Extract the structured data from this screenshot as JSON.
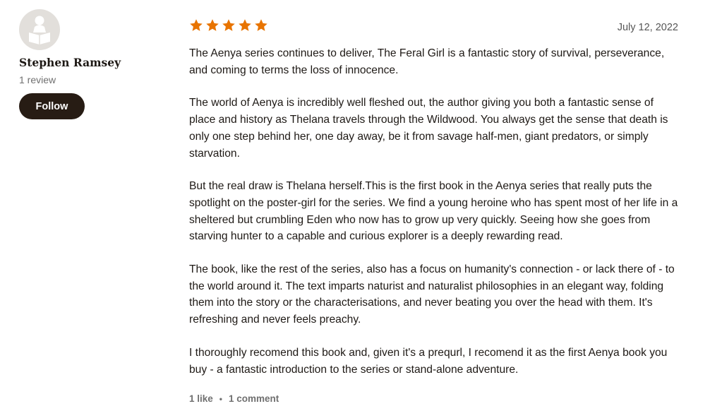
{
  "reviewer": {
    "name": "Stephen Ramsey",
    "review_count": "1 review",
    "follow_label": "Follow",
    "avatar_icon": "reader-silhouette-icon"
  },
  "review": {
    "rating": 5,
    "max_rating": 5,
    "star_color": "#e87400",
    "date": "July 12, 2022",
    "paragraphs": [
      "The Aenya series continues to deliver, The Feral Girl is a fantastic story of survival, perseverance, and coming to terms the loss of innocence.",
      "The world of Aenya is incredibly well fleshed out, the author giving you both a fantastic sense of place and history as Thelana travels through the Wildwood. You always get the sense that death is only one step behind her, one day away, be it from savage half-men, giant predators, or simply starvation.",
      "But the real draw is Thelana herself.This is the first book in the Aenya series that really puts the spotlight on the poster-girl for the series. We find a young heroine who has spent most of her life in a sheltered but crumbling Eden who now has to grow up very quickly. Seeing how she goes from starving hunter to a capable and curious explorer is a deeply rewarding read.",
      "The book, like the rest of the series, also has a focus on humanity's connection - or lack there of - to the world around it. The text imparts naturist and naturalist philosophies in an elegant way, folding them into the story or the characterisations, and never beating you over the head with them. It's refreshing and never feels preachy.",
      "I thoroughly recomend this book and, given it's a prequrl, I recomend it as the first Aenya book you buy - a fantastic introduction to the series or stand-alone adventure."
    ],
    "likes": "1 like",
    "separator": "•",
    "comments": "1 comment"
  }
}
